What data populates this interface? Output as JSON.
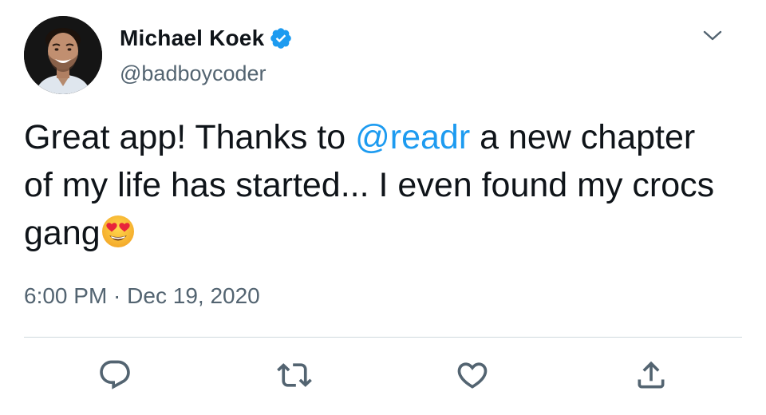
{
  "author": {
    "display_name": "Michael Koek",
    "handle": "@badboycoder",
    "verified": true,
    "verified_icon": "verified-badge-icon",
    "verified_color": "#1d9bf0",
    "avatar": "profile-photo"
  },
  "menu": {
    "icon": "chevron-down-icon"
  },
  "tweet": {
    "text_before": "Great app! Thanks to ",
    "mention": "@readr",
    "text_after": " a new chapter of my life has started... I even found my crocs gang",
    "emoji": "smiling-face-with-heart-eyes",
    "mention_color": "#1d9bf0"
  },
  "meta": {
    "time": "6:00 PM",
    "separator": " · ",
    "date": "Dec 19, 2020"
  },
  "actions": [
    {
      "name": "reply",
      "icon": "reply-icon"
    },
    {
      "name": "retweet",
      "icon": "retweet-icon"
    },
    {
      "name": "like",
      "icon": "heart-icon"
    },
    {
      "name": "share",
      "icon": "share-icon"
    }
  ],
  "colors": {
    "text": "#0f1419",
    "secondary": "#536471",
    "divider": "#cfd9de",
    "accent": "#1d9bf0"
  }
}
